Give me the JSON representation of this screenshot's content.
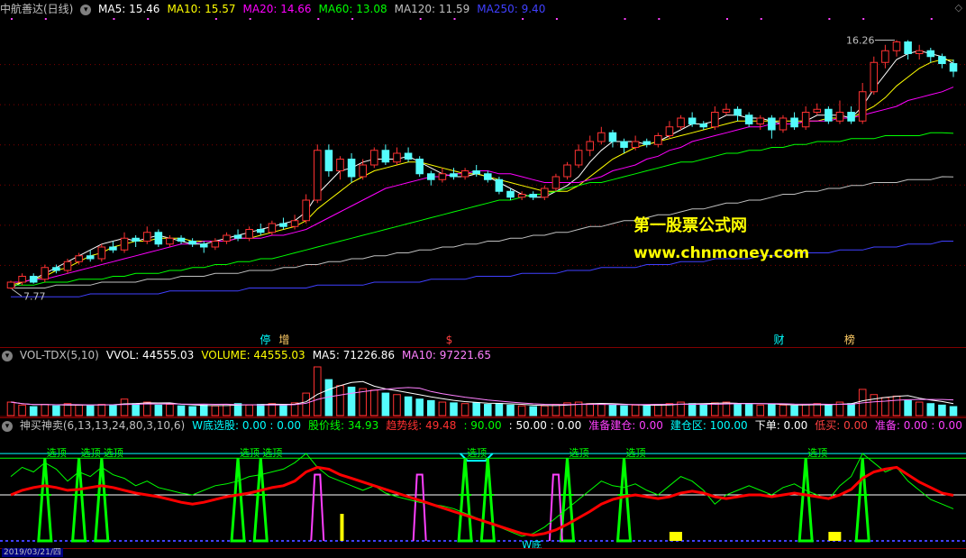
{
  "main": {
    "title": "中航善达(日线)",
    "ma_labels": [
      {
        "text": "MA5: 15.46",
        "color": "#ffffff"
      },
      {
        "text": "MA10: 15.57",
        "color": "#ffff00"
      },
      {
        "text": "MA20: 14.66",
        "color": "#ff00ff"
      },
      {
        "text": "MA60: 13.08",
        "color": "#00ff00"
      },
      {
        "text": "MA120: 11.59",
        "color": "#c0c0c0"
      },
      {
        "text": "MA250: 9.40",
        "color": "#4040ff"
      }
    ],
    "high_label": "16.26",
    "low_label": "7.77",
    "watermark_cn": "第一股票公式网",
    "watermark_url": "www.chnmoney.com",
    "event_marks": [
      {
        "text": "停",
        "color": "#00ffff"
      },
      {
        "text": "增",
        "color": "#ffcc66"
      },
      {
        "text": "$",
        "color": "#ff4040"
      },
      {
        "text": "财",
        "color": "#00ffff"
      },
      {
        "text": "榜",
        "color": "#ffcc66"
      }
    ]
  },
  "volume": {
    "labels": [
      {
        "text": "VOL-TDX(5,10)",
        "color": "#c0c0c0"
      },
      {
        "text": "VVOL: 44555.03",
        "color": "#ffffff"
      },
      {
        "text": "VOLUME: 44555.03",
        "color": "#ffff00"
      },
      {
        "text": "MA5: 71226.86",
        "color": "#ffffff"
      },
      {
        "text": "MA10: 97221.65",
        "color": "#ff80ff"
      }
    ]
  },
  "indicator": {
    "labels": [
      {
        "text": "神买神卖(6,13,13,24,80,3,10,6)",
        "color": "#c0c0c0"
      },
      {
        "text": "W底选股: 0.00 : 0.00",
        "color": "#00ffff"
      },
      {
        "text": "股价线: 34.93",
        "color": "#00ff00"
      },
      {
        "text": "趋势线: 49.48",
        "color": "#ff3030"
      },
      {
        "text": ": 90.00",
        "color": "#00ff00"
      },
      {
        "text": ": 50.00 : 0.00",
        "color": "#ffffff"
      },
      {
        "text": "准备建仓: 0.00",
        "color": "#ff40ff"
      },
      {
        "text": "建仓区: 100.00",
        "color": "#00ffff"
      },
      {
        "text": "下单: 0.00",
        "color": "#ffffff"
      },
      {
        "text": "低买: 0.00",
        "color": "#ff4040"
      },
      {
        "text": "准备: 0.00 : 0.00",
        "color": "#ff40ff"
      }
    ],
    "peak_label": "选顶",
    "w_label": "W底",
    "date_label": "2019/03/21/四"
  },
  "chart_data": {
    "type": "candlestick",
    "price_range": [
      7.2,
      16.8
    ],
    "candles": [
      [
        7.8,
        8.0,
        7.77,
        8.05
      ],
      [
        8.0,
        8.2,
        7.9,
        8.3
      ],
      [
        8.2,
        8.0,
        7.95,
        8.3
      ],
      [
        8.1,
        8.5,
        8.0,
        8.6
      ],
      [
        8.5,
        8.4,
        8.3,
        8.6
      ],
      [
        8.4,
        8.7,
        8.3,
        8.8
      ],
      [
        8.7,
        8.9,
        8.6,
        9.0
      ],
      [
        8.9,
        8.8,
        8.7,
        9.1
      ],
      [
        8.8,
        9.2,
        8.7,
        9.3
      ],
      [
        9.2,
        9.1,
        9.0,
        9.4
      ],
      [
        9.1,
        9.5,
        9.0,
        9.7
      ],
      [
        9.5,
        9.4,
        9.2,
        9.6
      ],
      [
        9.4,
        9.7,
        9.3,
        9.9
      ],
      [
        9.7,
        9.3,
        9.2,
        9.8
      ],
      [
        9.3,
        9.5,
        9.2,
        9.6
      ],
      [
        9.5,
        9.4,
        9.3,
        9.6
      ],
      [
        9.4,
        9.3,
        9.2,
        9.5
      ],
      [
        9.3,
        9.2,
        9.0,
        9.4
      ],
      [
        9.2,
        9.4,
        9.1,
        9.5
      ],
      [
        9.4,
        9.6,
        9.3,
        9.7
      ],
      [
        9.6,
        9.5,
        9.4,
        9.8
      ],
      [
        9.5,
        9.8,
        9.4,
        9.9
      ],
      [
        9.8,
        9.7,
        9.6,
        10.0
      ],
      [
        9.7,
        10.0,
        9.6,
        10.1
      ],
      [
        10.0,
        9.9,
        9.8,
        10.2
      ],
      [
        9.9,
        10.1,
        9.8,
        10.3
      ],
      [
        10.1,
        10.8,
        10.0,
        11.0
      ],
      [
        10.8,
        12.5,
        10.7,
        12.7
      ],
      [
        12.5,
        11.8,
        11.6,
        12.7
      ],
      [
        11.8,
        12.2,
        11.5,
        12.3
      ],
      [
        12.2,
        11.6,
        11.4,
        12.4
      ],
      [
        11.6,
        12.0,
        11.5,
        12.2
      ],
      [
        12.0,
        12.5,
        11.9,
        12.6
      ],
      [
        12.5,
        12.1,
        12.0,
        12.7
      ],
      [
        12.1,
        12.4,
        12.0,
        12.6
      ],
      [
        12.4,
        12.2,
        12.1,
        12.6
      ],
      [
        12.2,
        11.7,
        11.6,
        12.3
      ],
      [
        11.7,
        11.5,
        11.3,
        11.8
      ],
      [
        11.5,
        11.7,
        11.4,
        11.9
      ],
      [
        11.7,
        11.6,
        11.5,
        11.9
      ],
      [
        11.6,
        11.8,
        11.5,
        11.9
      ],
      [
        11.8,
        11.7,
        11.6,
        12.0
      ],
      [
        11.7,
        11.5,
        11.4,
        11.8
      ],
      [
        11.5,
        11.1,
        11.0,
        11.6
      ],
      [
        11.1,
        10.9,
        10.8,
        11.2
      ],
      [
        10.9,
        11.0,
        10.8,
        11.1
      ],
      [
        11.0,
        10.9,
        10.8,
        11.1
      ],
      [
        10.9,
        11.2,
        10.8,
        11.3
      ],
      [
        11.2,
        11.6,
        11.1,
        11.7
      ],
      [
        11.6,
        12.0,
        11.5,
        12.1
      ],
      [
        12.0,
        12.5,
        11.9,
        12.7
      ],
      [
        12.5,
        12.8,
        12.3,
        13.0
      ],
      [
        12.8,
        13.1,
        12.7,
        13.3
      ],
      [
        13.1,
        12.8,
        12.6,
        13.2
      ],
      [
        12.8,
        12.6,
        12.4,
        12.9
      ],
      [
        12.6,
        12.8,
        12.5,
        13.0
      ],
      [
        12.8,
        12.7,
        12.6,
        12.9
      ],
      [
        12.7,
        13.0,
        12.6,
        13.1
      ],
      [
        13.0,
        13.3,
        12.9,
        13.5
      ],
      [
        13.3,
        13.6,
        13.2,
        13.7
      ],
      [
        13.6,
        13.4,
        13.3,
        13.8
      ],
      [
        13.4,
        13.3,
        13.2,
        13.5
      ],
      [
        13.3,
        13.8,
        13.2,
        14.0
      ],
      [
        13.8,
        13.9,
        13.7,
        14.1
      ],
      [
        13.9,
        13.7,
        13.5,
        14.0
      ],
      [
        13.7,
        13.4,
        13.3,
        13.8
      ],
      [
        13.4,
        13.6,
        13.2,
        13.7
      ],
      [
        13.6,
        13.2,
        12.9,
        13.7
      ],
      [
        13.2,
        13.6,
        13.1,
        13.7
      ],
      [
        13.6,
        13.3,
        13.2,
        13.8
      ],
      [
        13.3,
        13.8,
        13.2,
        14.0
      ],
      [
        13.8,
        13.9,
        13.7,
        14.1
      ],
      [
        13.9,
        13.5,
        13.4,
        14.0
      ],
      [
        13.5,
        13.8,
        13.4,
        14.2
      ],
      [
        13.8,
        13.5,
        13.4,
        14.0
      ],
      [
        13.5,
        14.5,
        13.4,
        14.8
      ],
      [
        14.5,
        15.5,
        14.4,
        15.7
      ],
      [
        15.5,
        15.9,
        15.3,
        16.1
      ],
      [
        15.9,
        16.2,
        15.7,
        16.26
      ],
      [
        16.2,
        15.8,
        15.6,
        16.26
      ],
      [
        15.8,
        15.9,
        15.6,
        16.1
      ],
      [
        15.9,
        15.7,
        15.5,
        16.0
      ],
      [
        15.7,
        15.46,
        15.3,
        15.8
      ],
      [
        15.46,
        15.2,
        15.0,
        15.6
      ]
    ],
    "ma_lines": {
      "MA5": [
        7.8,
        8.0,
        8.1,
        8.3,
        8.5,
        8.7,
        8.9,
        9.1,
        9.3,
        9.4,
        9.5,
        9.4,
        9.5,
        9.6,
        9.5,
        9.4,
        9.3,
        9.3,
        9.4,
        9.5,
        9.6,
        9.7,
        9.8,
        9.9,
        10.0,
        10.1,
        10.4,
        11.0,
        11.4,
        11.8,
        11.9,
        12.1,
        12.2,
        12.2,
        12.2,
        12.3,
        12.1,
        11.9,
        11.7,
        11.6,
        11.6,
        11.7,
        11.6,
        11.4,
        11.2,
        11.0,
        10.9,
        10.9,
        11.1,
        11.3,
        11.6,
        12.1,
        12.5,
        12.8,
        12.8,
        12.8,
        12.7,
        12.8,
        13.0,
        13.2,
        13.4,
        13.4,
        13.5,
        13.7,
        13.7,
        13.6,
        13.6,
        13.5,
        13.4,
        13.4,
        13.5,
        13.7,
        13.7,
        13.7,
        13.6,
        14.0,
        14.6,
        15.1,
        15.6,
        15.8,
        15.9,
        15.8,
        15.7,
        15.46
      ],
      "MA10": [
        7.9,
        8.0,
        8.1,
        8.2,
        8.4,
        8.5,
        8.7,
        8.9,
        9.0,
        9.2,
        9.3,
        9.4,
        9.4,
        9.5,
        9.5,
        9.5,
        9.4,
        9.4,
        9.4,
        9.4,
        9.5,
        9.5,
        9.6,
        9.7,
        9.8,
        9.9,
        10.1,
        10.5,
        10.8,
        11.1,
        11.4,
        11.6,
        11.8,
        11.9,
        12.0,
        12.1,
        12.1,
        12.0,
        11.9,
        11.8,
        11.7,
        11.7,
        11.6,
        11.5,
        11.4,
        11.3,
        11.2,
        11.1,
        11.1,
        11.1,
        11.3,
        11.6,
        11.9,
        12.2,
        12.4,
        12.6,
        12.7,
        12.8,
        12.9,
        13.0,
        13.1,
        13.2,
        13.3,
        13.4,
        13.5,
        13.5,
        13.5,
        13.5,
        13.5,
        13.5,
        13.5,
        13.5,
        13.6,
        13.6,
        13.6,
        13.8,
        14.0,
        14.3,
        14.7,
        15.0,
        15.3,
        15.5,
        15.6,
        15.57
      ],
      "MA20": [
        8.0,
        8.0,
        8.1,
        8.1,
        8.2,
        8.3,
        8.4,
        8.5,
        8.6,
        8.7,
        8.8,
        8.9,
        9.0,
        9.1,
        9.2,
        9.3,
        9.3,
        9.4,
        9.4,
        9.4,
        9.5,
        9.5,
        9.5,
        9.6,
        9.6,
        9.7,
        9.8,
        10.0,
        10.2,
        10.4,
        10.6,
        10.8,
        11.0,
        11.2,
        11.3,
        11.4,
        11.5,
        11.6,
        11.6,
        11.7,
        11.7,
        11.8,
        11.8,
        11.7,
        11.7,
        11.6,
        11.5,
        11.4,
        11.4,
        11.4,
        11.4,
        11.5,
        11.6,
        11.8,
        11.9,
        12.0,
        12.2,
        12.3,
        12.5,
        12.6,
        12.8,
        12.9,
        13.0,
        13.1,
        13.2,
        13.3,
        13.3,
        13.4,
        13.4,
        13.4,
        13.5,
        13.5,
        13.5,
        13.6,
        13.6,
        13.7,
        13.8,
        13.9,
        14.0,
        14.2,
        14.3,
        14.4,
        14.5,
        14.66
      ],
      "MA60": [
        7.9,
        7.9,
        7.9,
        8.0,
        8.0,
        8.0,
        8.1,
        8.1,
        8.1,
        8.2,
        8.2,
        8.3,
        8.3,
        8.3,
        8.4,
        8.4,
        8.5,
        8.5,
        8.6,
        8.6,
        8.7,
        8.7,
        8.8,
        8.8,
        8.9,
        9.0,
        9.1,
        9.2,
        9.3,
        9.4,
        9.5,
        9.6,
        9.7,
        9.8,
        9.9,
        10.0,
        10.1,
        10.2,
        10.3,
        10.4,
        10.5,
        10.6,
        10.7,
        10.8,
        10.8,
        10.9,
        11.0,
        11.0,
        11.1,
        11.2,
        11.3,
        11.4,
        11.4,
        11.5,
        11.6,
        11.7,
        11.8,
        11.9,
        12.0,
        12.1,
        12.1,
        12.2,
        12.3,
        12.4,
        12.4,
        12.5,
        12.5,
        12.6,
        12.6,
        12.7,
        12.7,
        12.8,
        12.8,
        12.8,
        12.9,
        12.9,
        12.9,
        13.0,
        13.0,
        13.0,
        13.0,
        13.1,
        13.1,
        13.08
      ],
      "MA120": [
        7.8,
        7.8,
        7.8,
        7.8,
        7.9,
        7.9,
        7.9,
        7.9,
        8.0,
        8.0,
        8.0,
        8.0,
        8.1,
        8.1,
        8.1,
        8.2,
        8.2,
        8.2,
        8.3,
        8.3,
        8.3,
        8.4,
        8.4,
        8.4,
        8.5,
        8.5,
        8.6,
        8.6,
        8.7,
        8.7,
        8.8,
        8.8,
        8.9,
        8.9,
        9.0,
        9.0,
        9.1,
        9.1,
        9.2,
        9.2,
        9.3,
        9.3,
        9.4,
        9.4,
        9.5,
        9.5,
        9.6,
        9.6,
        9.7,
        9.7,
        9.8,
        9.9,
        9.9,
        10.0,
        10.1,
        10.1,
        10.2,
        10.3,
        10.3,
        10.4,
        10.5,
        10.5,
        10.6,
        10.7,
        10.7,
        10.8,
        10.8,
        10.9,
        11.0,
        11.0,
        11.1,
        11.1,
        11.2,
        11.2,
        11.3,
        11.3,
        11.4,
        11.4,
        11.4,
        11.5,
        11.5,
        11.5,
        11.6,
        11.59
      ],
      "MA250": [
        7.5,
        7.5,
        7.5,
        7.5,
        7.5,
        7.5,
        7.5,
        7.6,
        7.6,
        7.6,
        7.6,
        7.6,
        7.6,
        7.6,
        7.7,
        7.7,
        7.7,
        7.7,
        7.7,
        7.7,
        7.7,
        7.8,
        7.8,
        7.8,
        7.8,
        7.8,
        7.8,
        7.9,
        7.9,
        7.9,
        7.9,
        7.9,
        8.0,
        8.0,
        8.0,
        8.0,
        8.0,
        8.1,
        8.1,
        8.1,
        8.1,
        8.2,
        8.2,
        8.2,
        8.2,
        8.3,
        8.3,
        8.3,
        8.3,
        8.4,
        8.4,
        8.4,
        8.5,
        8.5,
        8.5,
        8.5,
        8.6,
        8.6,
        8.6,
        8.7,
        8.7,
        8.7,
        8.8,
        8.8,
        8.8,
        8.8,
        8.9,
        8.9,
        8.9,
        9.0,
        9.0,
        9.0,
        9.0,
        9.1,
        9.1,
        9.1,
        9.2,
        9.2,
        9.2,
        9.3,
        9.3,
        9.3,
        9.4,
        9.4
      ]
    },
    "volume_values": [
      18,
      14,
      12,
      15,
      13,
      16,
      14,
      13,
      15,
      14,
      22,
      16,
      18,
      14,
      15,
      13,
      12,
      14,
      13,
      15,
      16,
      14,
      15,
      16,
      14,
      17,
      30,
      65,
      48,
      40,
      38,
      36,
      34,
      30,
      28,
      25,
      22,
      20,
      18,
      17,
      16,
      17,
      15,
      16,
      14,
      13,
      12,
      13,
      15,
      17,
      18,
      16,
      15,
      14,
      13,
      14,
      13,
      15,
      16,
      18,
      16,
      15,
      17,
      18,
      16,
      15,
      14,
      15,
      14,
      13,
      15,
      16,
      14,
      18,
      16,
      35,
      28,
      24,
      26,
      20,
      18,
      16,
      14,
      12
    ],
    "indicator_range": [
      0,
      100
    ],
    "price_line": [
      70,
      80,
      75,
      85,
      78,
      65,
      75,
      70,
      80,
      72,
      68,
      60,
      65,
      58,
      55,
      52,
      50,
      55,
      60,
      62,
      65,
      70,
      72,
      75,
      78,
      85,
      95,
      80,
      70,
      65,
      60,
      55,
      60,
      52,
      48,
      45,
      42,
      40,
      38,
      35,
      30,
      25,
      20,
      15,
      10,
      5,
      8,
      15,
      25,
      35,
      45,
      55,
      65,
      60,
      58,
      62,
      55,
      50,
      60,
      70,
      65,
      55,
      40,
      50,
      55,
      60,
      55,
      50,
      58,
      62,
      55,
      50,
      45,
      60,
      70,
      95,
      85,
      75,
      80,
      65,
      55,
      45,
      40,
      34.93
    ],
    "trend_line": [
      50,
      55,
      58,
      60,
      58,
      55,
      56,
      58,
      60,
      58,
      55,
      52,
      50,
      48,
      45,
      42,
      40,
      42,
      45,
      48,
      50,
      52,
      55,
      58,
      60,
      65,
      75,
      80,
      78,
      72,
      68,
      64,
      60,
      56,
      52,
      48,
      44,
      40,
      36,
      32,
      28,
      24,
      20,
      16,
      12,
      8,
      6,
      8,
      12,
      18,
      25,
      32,
      40,
      45,
      48,
      50,
      48,
      46,
      48,
      52,
      54,
      52,
      48,
      46,
      48,
      50,
      50,
      48,
      50,
      52,
      50,
      48,
      46,
      50,
      56,
      68,
      75,
      78,
      80,
      72,
      64,
      58,
      52,
      49.48
    ],
    "overbought_level": 90,
    "top_level": 95,
    "mid_level": 50,
    "peak_markers": [
      3,
      6,
      8,
      20,
      22,
      40,
      42,
      49,
      54,
      70,
      75
    ],
    "magenta_peaks": [
      27,
      36,
      48
    ],
    "yellow_bars": [
      29,
      58,
      72
    ]
  }
}
